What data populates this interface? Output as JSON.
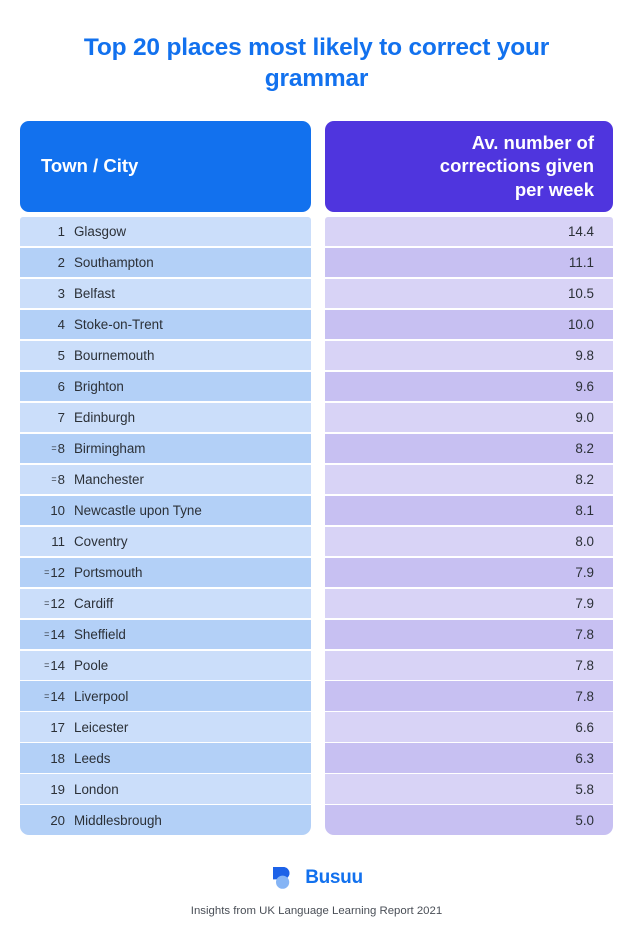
{
  "title": "Top 20 places most likely to correct your grammar",
  "colors": {
    "title_blue": "#1271ee",
    "header_blue": "#1271ee",
    "header_purple": "#4f35de",
    "row_blue_light": "#cbdefa",
    "row_blue_dark": "#b3d0f7",
    "row_purple_light": "#d8d3f6",
    "row_purple_dark": "#c7c0f2",
    "body_text": "#2b3037",
    "footer_text": "#4a4f57"
  },
  "table": {
    "headers": {
      "left": "Town / City",
      "right_line1": "Av. number of",
      "right_line2": "corrections given",
      "right_line3": "per week"
    },
    "rows": [
      {
        "rank": "1",
        "tied": false,
        "place": "Glasgow",
        "value": "14.4"
      },
      {
        "rank": "2",
        "tied": false,
        "place": "Southampton",
        "value": "11.1"
      },
      {
        "rank": "3",
        "tied": false,
        "place": "Belfast",
        "value": "10.5"
      },
      {
        "rank": "4",
        "tied": false,
        "place": "Stoke-on-Trent",
        "value": "10.0"
      },
      {
        "rank": "5",
        "tied": false,
        "place": "Bournemouth",
        "value": "9.8"
      },
      {
        "rank": "6",
        "tied": false,
        "place": "Brighton",
        "value": "9.6"
      },
      {
        "rank": "7",
        "tied": false,
        "place": "Edinburgh",
        "value": "9.0"
      },
      {
        "rank": "8",
        "tied": true,
        "place": "Birmingham",
        "value": "8.2"
      },
      {
        "rank": "8",
        "tied": true,
        "place": "Manchester",
        "value": "8.2"
      },
      {
        "rank": "10",
        "tied": false,
        "place": "Newcastle upon Tyne",
        "value": "8.1"
      },
      {
        "rank": "11",
        "tied": false,
        "place": "Coventry",
        "value": "8.0"
      },
      {
        "rank": "12",
        "tied": true,
        "place": "Portsmouth",
        "value": "7.9"
      },
      {
        "rank": "12",
        "tied": true,
        "place": "Cardiff",
        "value": "7.9"
      },
      {
        "rank": "14",
        "tied": true,
        "place": "Sheffield",
        "value": "7.8"
      },
      {
        "rank": "14",
        "tied": true,
        "place": "Poole",
        "value": "7.8"
      },
      {
        "rank": "14",
        "tied": true,
        "place": "Liverpool",
        "value": "7.8"
      },
      {
        "rank": "17",
        "tied": false,
        "place": "Leicester",
        "value": "6.6"
      },
      {
        "rank": "18",
        "tied": false,
        "place": "Leeds",
        "value": "6.3"
      },
      {
        "rank": "19",
        "tied": false,
        "place": "London",
        "value": "5.8"
      },
      {
        "rank": "20",
        "tied": false,
        "place": "Middlesbrough",
        "value": "5.0"
      }
    ]
  },
  "footer": {
    "brand": "Busuu",
    "note": "Insights from UK Language Learning Report 2021"
  },
  "chart_data": {
    "type": "table",
    "title": "Top 20 places most likely to correct your grammar",
    "subtitle": "Insights from UK Language Learning Report 2021",
    "columns": [
      "Rank",
      "Town / City",
      "Av. number of corrections given per week"
    ],
    "xlabel": "Town / City",
    "ylabel": "Av. number of corrections given per week",
    "categories": [
      "Glasgow",
      "Southampton",
      "Belfast",
      "Stoke-on-Trent",
      "Bournemouth",
      "Brighton",
      "Edinburgh",
      "Birmingham",
      "Manchester",
      "Newcastle upon Tyne",
      "Coventry",
      "Portsmouth",
      "Cardiff",
      "Sheffield",
      "Poole",
      "Liverpool",
      "Leicester",
      "Leeds",
      "London",
      "Middlesbrough"
    ],
    "values": [
      14.4,
      11.1,
      10.5,
      10.0,
      9.8,
      9.6,
      9.0,
      8.2,
      8.2,
      8.1,
      8.0,
      7.9,
      7.9,
      7.8,
      7.8,
      7.8,
      6.6,
      6.3,
      5.8,
      5.0
    ],
    "ranks": [
      "1",
      "2",
      "3",
      "4",
      "5",
      "6",
      "7",
      "=8",
      "=8",
      "10",
      "11",
      "=12",
      "=12",
      "=14",
      "=14",
      "=14",
      "17",
      "18",
      "19",
      "20"
    ],
    "ylim": [
      0,
      14.4
    ],
    "grid": false,
    "legend": false
  }
}
